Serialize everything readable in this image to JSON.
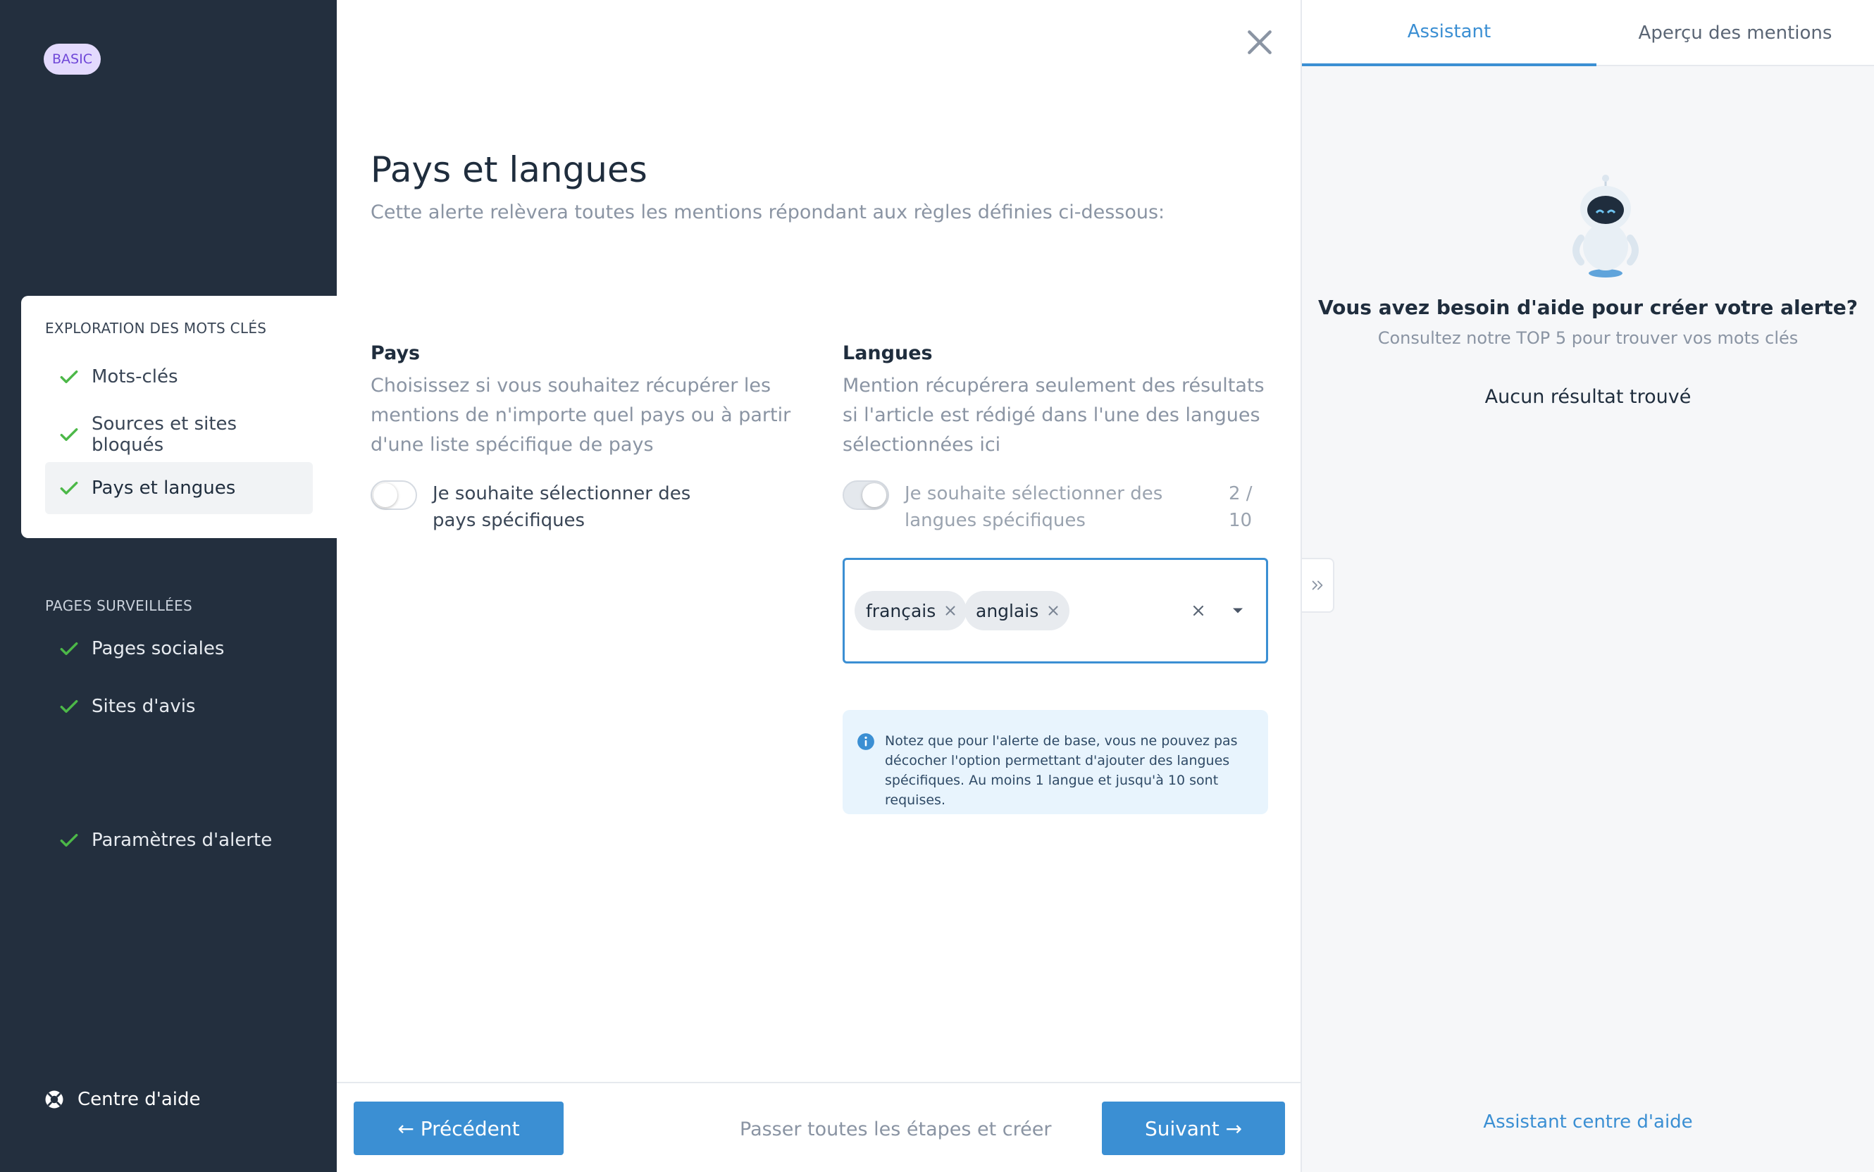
{
  "sidebar": {
    "badge": "BASIC",
    "section1_title": "EXPLORATION DES MOTS CLÉS",
    "section1_items": [
      {
        "label": "Mots-clés"
      },
      {
        "label": "Sources et sites bloqués"
      },
      {
        "label": "Pays et langues"
      }
    ],
    "section2_title": "PAGES SURVEILLÉES",
    "section2_items": [
      {
        "label": "Pages sociales"
      },
      {
        "label": "Sites d'avis"
      }
    ],
    "settings_item": "Paramètres d'alerte",
    "help_center": "Centre d'aide",
    "check_color": "#4cb848"
  },
  "main": {
    "title": "Pays et langues",
    "subtitle": "Cette alerte relèvera toutes les mentions répondant aux règles définies ci-dessous:",
    "pays": {
      "heading": "Pays",
      "description": "Choisissez si vous souhaitez récupérer les mentions de n'importe quel pays ou à partir d'une liste spécifique de pays",
      "toggle_label": "Je souhaite sélectionner des pays spécifiques",
      "toggle_on": false
    },
    "langues": {
      "heading": "Langues",
      "description": "Mention récupérera seulement des résultats si l'article est rédigé dans l'une des langues sélectionnées ici",
      "toggle_label": "Je souhaite sélectionner des langues spécifiques",
      "counter": "2 / 10",
      "selected": [
        "français",
        "anglais"
      ]
    },
    "info_note": "Notez que pour l'alerte de base, vous ne pouvez pas décocher l'option permettant d'ajouter des langues spécifiques. Au moins 1 langue et jusqu'à 10 sont requises.",
    "footer": {
      "prev_label": "← Précédent",
      "skip_label": "Passer toutes les étapes et créer",
      "next_label": "Suivant →"
    }
  },
  "right_panel": {
    "tabs": [
      "Assistant",
      "Aperçu des mentions"
    ],
    "help_title": "Vous avez besoin d'aide pour créer votre alerte?",
    "help_subtitle": "Consultez notre TOP 5 pour trouver vos mots clés",
    "no_result": "Aucun résultat trouvé",
    "assistant_link": "Assistant centre d'aide",
    "accent_color": "#3b8fd3"
  }
}
